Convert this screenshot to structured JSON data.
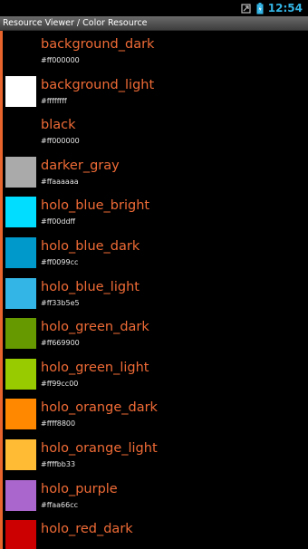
{
  "status_bar": {
    "time": "12:54",
    "icons": [
      "usb-debug-icon",
      "battery-icon"
    ],
    "accent_color": "#33b5e5"
  },
  "title_bar": {
    "title": "Resource Viewer / Color Resource"
  },
  "colors": {
    "name_text": "#ef6b36",
    "accent": "#e8642c"
  },
  "resources": [
    {
      "name": "background_dark",
      "hex": "#ff000000",
      "swatch": "#000000"
    },
    {
      "name": "background_light",
      "hex": "#ffffffff",
      "swatch": "#ffffff"
    },
    {
      "name": "black",
      "hex": "#ff000000",
      "swatch": "#000000"
    },
    {
      "name": "darker_gray",
      "hex": "#ffaaaaaa",
      "swatch": "#aaaaaa"
    },
    {
      "name": "holo_blue_bright",
      "hex": "#ff00ddff",
      "swatch": "#00ddff"
    },
    {
      "name": "holo_blue_dark",
      "hex": "#ff0099cc",
      "swatch": "#0099cc"
    },
    {
      "name": "holo_blue_light",
      "hex": "#ff33b5e5",
      "swatch": "#33b5e5"
    },
    {
      "name": "holo_green_dark",
      "hex": "#ff669900",
      "swatch": "#669900"
    },
    {
      "name": "holo_green_light",
      "hex": "#ff99cc00",
      "swatch": "#99cc00"
    },
    {
      "name": "holo_orange_dark",
      "hex": "#ffff8800",
      "swatch": "#ff8800"
    },
    {
      "name": "holo_orange_light",
      "hex": "#ffffbb33",
      "swatch": "#ffbb33"
    },
    {
      "name": "holo_purple",
      "hex": "#ffaa66cc",
      "swatch": "#aa66cc"
    },
    {
      "name": "holo_red_dark",
      "hex": "",
      "swatch": "#cc0000"
    }
  ]
}
